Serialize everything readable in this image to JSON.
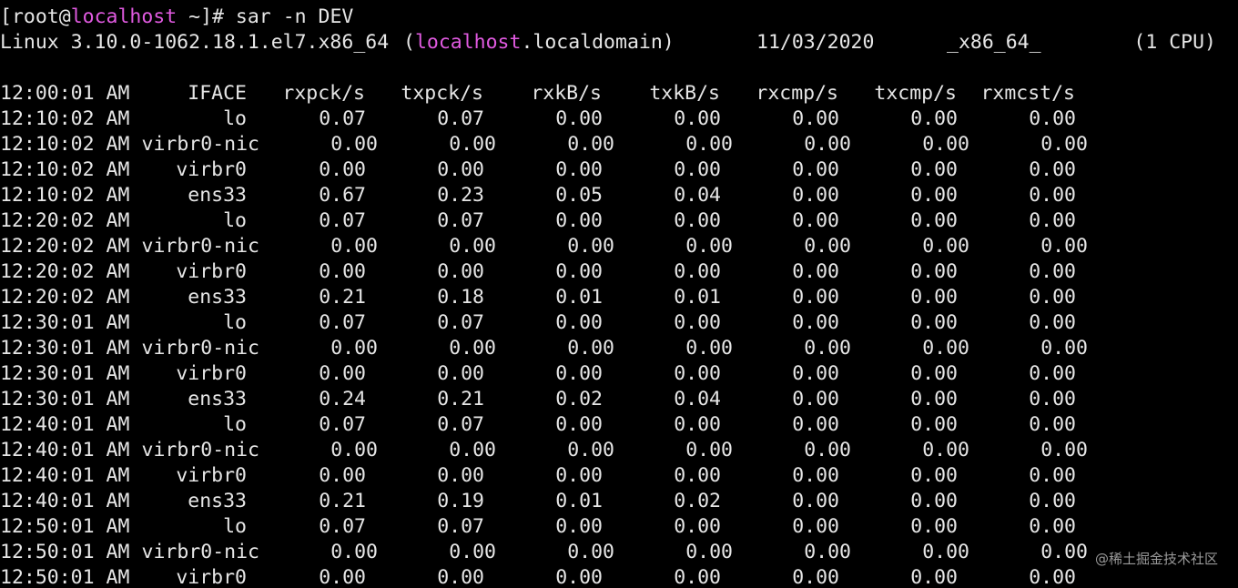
{
  "prompt": {
    "open": "[",
    "user": "root",
    "at": "@",
    "host": "localhost",
    "path_suffix": " ~]# ",
    "command": "sar -n DEV"
  },
  "sysinfo": {
    "kernel": "Linux 3.10.0-1062.18.1.el7.x86_64",
    "host_open": "(",
    "host": "localhost",
    "domain": ".localdomain)",
    "date": "11/03/2020",
    "arch": "_x86_64_",
    "cpu": "(1 CPU)"
  },
  "table": {
    "header": [
      "12:00:01 AM",
      "IFACE",
      "rxpck/s",
      "txpck/s",
      "rxkB/s",
      "txkB/s",
      "rxcmp/s",
      "txcmp/s",
      "rxmcst/s"
    ],
    "rows": [
      [
        "12:10:02 AM",
        "lo",
        "0.07",
        "0.07",
        "0.00",
        "0.00",
        "0.00",
        "0.00",
        "0.00"
      ],
      [
        "12:10:02 AM",
        "virbr0-nic",
        "0.00",
        "0.00",
        "0.00",
        "0.00",
        "0.00",
        "0.00",
        "0.00"
      ],
      [
        "12:10:02 AM",
        "virbr0",
        "0.00",
        "0.00",
        "0.00",
        "0.00",
        "0.00",
        "0.00",
        "0.00"
      ],
      [
        "12:10:02 AM",
        "ens33",
        "0.67",
        "0.23",
        "0.05",
        "0.04",
        "0.00",
        "0.00",
        "0.00"
      ],
      [
        "12:20:02 AM",
        "lo",
        "0.07",
        "0.07",
        "0.00",
        "0.00",
        "0.00",
        "0.00",
        "0.00"
      ],
      [
        "12:20:02 AM",
        "virbr0-nic",
        "0.00",
        "0.00",
        "0.00",
        "0.00",
        "0.00",
        "0.00",
        "0.00"
      ],
      [
        "12:20:02 AM",
        "virbr0",
        "0.00",
        "0.00",
        "0.00",
        "0.00",
        "0.00",
        "0.00",
        "0.00"
      ],
      [
        "12:20:02 AM",
        "ens33",
        "0.21",
        "0.18",
        "0.01",
        "0.01",
        "0.00",
        "0.00",
        "0.00"
      ],
      [
        "12:30:01 AM",
        "lo",
        "0.07",
        "0.07",
        "0.00",
        "0.00",
        "0.00",
        "0.00",
        "0.00"
      ],
      [
        "12:30:01 AM",
        "virbr0-nic",
        "0.00",
        "0.00",
        "0.00",
        "0.00",
        "0.00",
        "0.00",
        "0.00"
      ],
      [
        "12:30:01 AM",
        "virbr0",
        "0.00",
        "0.00",
        "0.00",
        "0.00",
        "0.00",
        "0.00",
        "0.00"
      ],
      [
        "12:30:01 AM",
        "ens33",
        "0.24",
        "0.21",
        "0.02",
        "0.04",
        "0.00",
        "0.00",
        "0.00"
      ],
      [
        "12:40:01 AM",
        "lo",
        "0.07",
        "0.07",
        "0.00",
        "0.00",
        "0.00",
        "0.00",
        "0.00"
      ],
      [
        "12:40:01 AM",
        "virbr0-nic",
        "0.00",
        "0.00",
        "0.00",
        "0.00",
        "0.00",
        "0.00",
        "0.00"
      ],
      [
        "12:40:01 AM",
        "virbr0",
        "0.00",
        "0.00",
        "0.00",
        "0.00",
        "0.00",
        "0.00",
        "0.00"
      ],
      [
        "12:40:01 AM",
        "ens33",
        "0.21",
        "0.19",
        "0.01",
        "0.02",
        "0.00",
        "0.00",
        "0.00"
      ],
      [
        "12:50:01 AM",
        "lo",
        "0.07",
        "0.07",
        "0.00",
        "0.00",
        "0.00",
        "0.00",
        "0.00"
      ],
      [
        "12:50:01 AM",
        "virbr0-nic",
        "0.00",
        "0.00",
        "0.00",
        "0.00",
        "0.00",
        "0.00",
        "0.00"
      ],
      [
        "12:50:01 AM",
        "virbr0",
        "0.00",
        "0.00",
        "0.00",
        "0.00",
        "0.00",
        "0.00",
        "0.00"
      ]
    ]
  },
  "watermark": "@稀土掘金技术社区",
  "colors": {
    "background": "#000000",
    "text": "#e6e6e6",
    "host_highlight": "#e05ae0"
  }
}
